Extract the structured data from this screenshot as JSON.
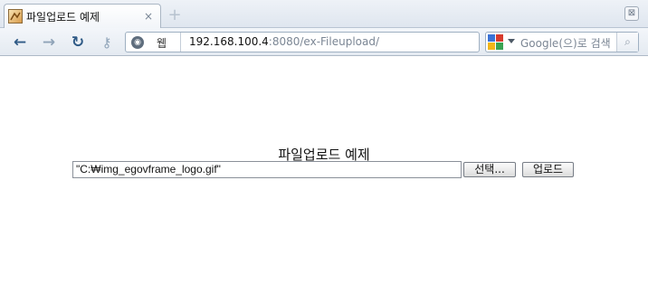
{
  "tab": {
    "title": "파일업로드 예제",
    "close": "×"
  },
  "newtab": {
    "label": "+"
  },
  "window": {
    "close": "⊠"
  },
  "nav": {
    "back": "←",
    "forward": "→",
    "reload": "↻",
    "key": "⚷"
  },
  "urlbar": {
    "label": "웹",
    "host": "192.168.100.4",
    "rest": ":8080/ex-Fileupload/"
  },
  "search": {
    "placeholder": "Google(으)로 검색",
    "go": "⌕"
  },
  "page": {
    "heading": "파일업로드 예제",
    "file_value": "\"C:₩img_egovframe_logo.gif\"",
    "browse_label": "선택...",
    "upload_label": "업로드"
  },
  "colors": {
    "accent": "#2f5a86",
    "chrome": "#e4eaf1",
    "border": "#9fb0c2"
  }
}
